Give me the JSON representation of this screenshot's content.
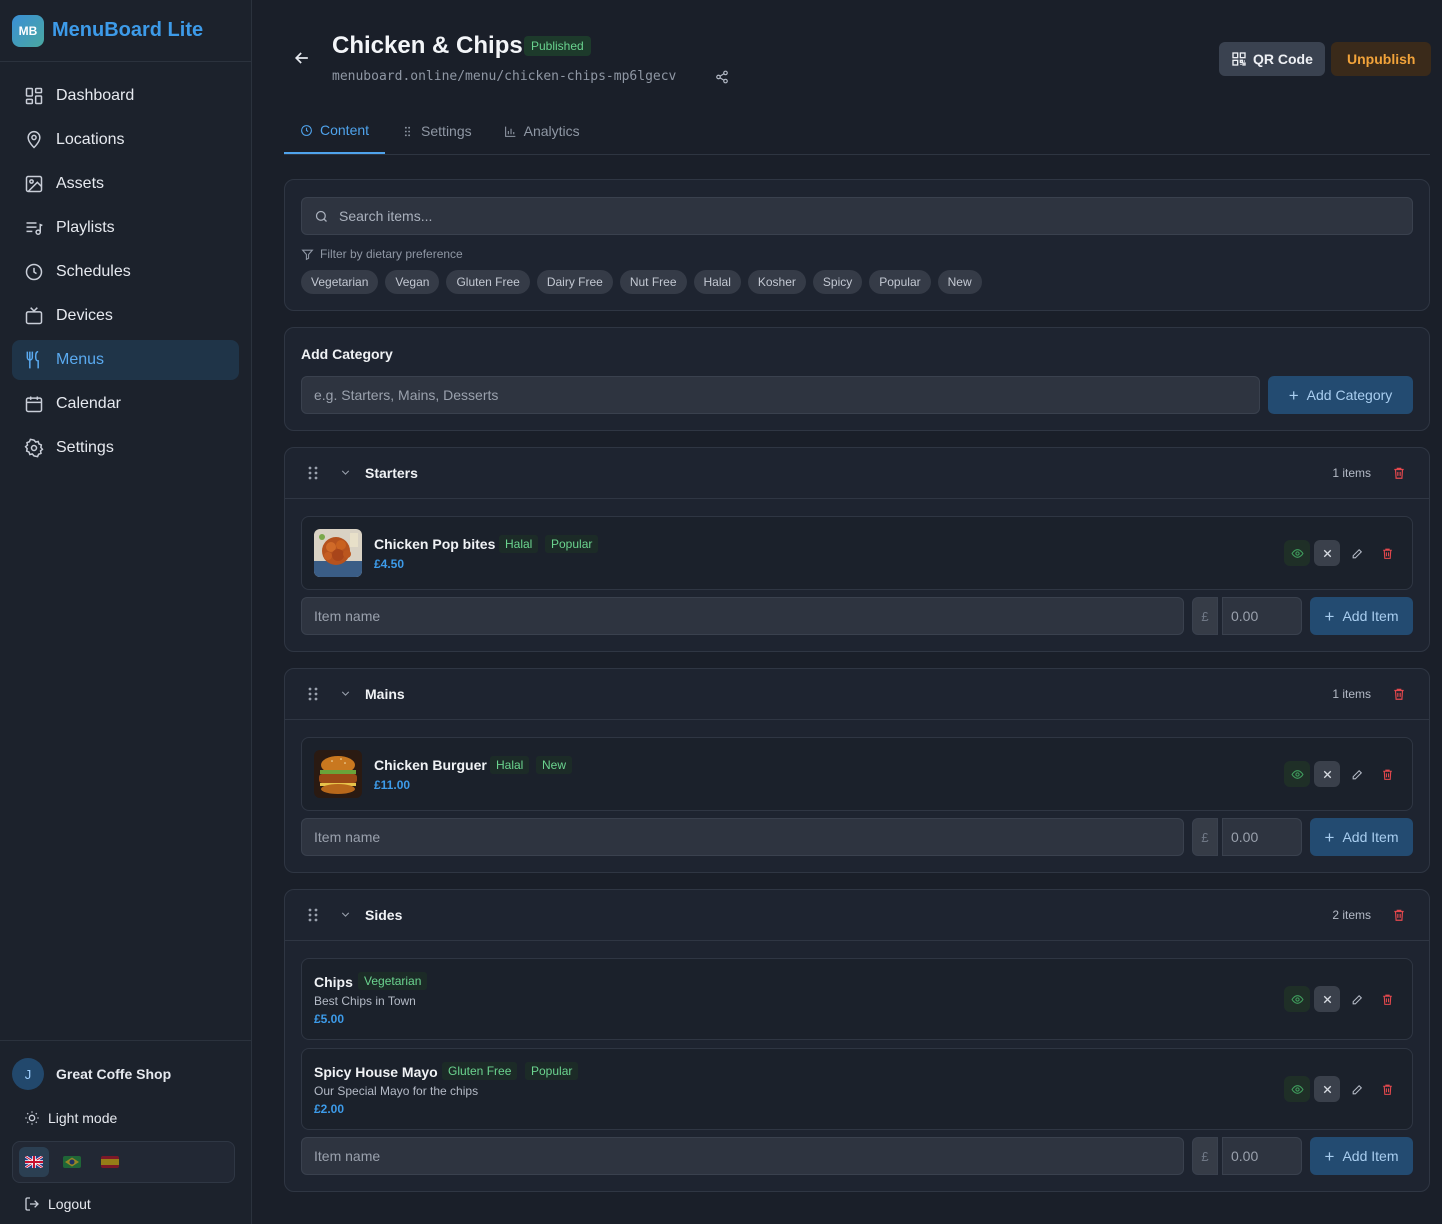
{
  "brand": {
    "logo": "MB",
    "name": "MenuBoard Lite"
  },
  "nav": [
    {
      "label": "Dashboard",
      "icon": "dashboard-icon"
    },
    {
      "label": "Locations",
      "icon": "map-pin-icon"
    },
    {
      "label": "Assets",
      "icon": "image-icon"
    },
    {
      "label": "Playlists",
      "icon": "playlist-icon"
    },
    {
      "label": "Schedules",
      "icon": "clock-icon"
    },
    {
      "label": "Devices",
      "icon": "tv-icon"
    },
    {
      "label": "Menus",
      "icon": "utensils-icon",
      "active": true
    },
    {
      "label": "Calendar",
      "icon": "calendar-icon"
    },
    {
      "label": "Settings",
      "icon": "gear-icon"
    }
  ],
  "user": {
    "initial": "J",
    "name": "Great Coffe Shop"
  },
  "mode_label": "Light mode",
  "languages": [
    "en-gb-flag",
    "pt-br-flag",
    "es-flag"
  ],
  "logout_label": "Logout",
  "header": {
    "title": "Chicken & Chips",
    "status": "Published",
    "url": "menuboard.online/menu/chicken-chips-mp6lgecv",
    "qr_label": "QR Code",
    "unpublish_label": "Unpublish"
  },
  "tabs": [
    {
      "label": "Content",
      "active": true
    },
    {
      "label": "Settings"
    },
    {
      "label": "Analytics"
    }
  ],
  "search": {
    "placeholder": "Search items...",
    "filter_label": "Filter by dietary preference",
    "chips": [
      "Vegetarian",
      "Vegan",
      "Gluten Free",
      "Dairy Free",
      "Nut Free",
      "Halal",
      "Kosher",
      "Spicy",
      "Popular",
      "New"
    ]
  },
  "add_category": {
    "heading": "Add Category",
    "placeholder": "e.g. Starters, Mains, Desserts",
    "button": "Add Category"
  },
  "new_item": {
    "name_placeholder": "Item name",
    "currency": "£",
    "price_placeholder": "0.00",
    "button": "Add Item"
  },
  "categories": [
    {
      "name": "Starters",
      "count": "1 items",
      "items": [
        {
          "name": "Chicken Pop bites",
          "tags": [
            "Halal",
            "Popular"
          ],
          "price": "£4.50",
          "image": "chicken-pop-bites-photo"
        }
      ]
    },
    {
      "name": "Mains",
      "count": "1 items",
      "items": [
        {
          "name": "Chicken Burguer",
          "tags": [
            "Halal",
            "New"
          ],
          "price": "£11.00",
          "image": "chicken-burger-photo"
        }
      ]
    },
    {
      "name": "Sides",
      "count": "2 items",
      "items": [
        {
          "name": "Chips",
          "tags": [
            "Vegetarian"
          ],
          "description": "Best Chips in Town",
          "price": "£5.00"
        },
        {
          "name": "Spicy House Mayo",
          "tags": [
            "Gluten Free",
            "Popular"
          ],
          "description": "Our Special Mayo for the chips",
          "price": "£2.00"
        }
      ]
    }
  ]
}
